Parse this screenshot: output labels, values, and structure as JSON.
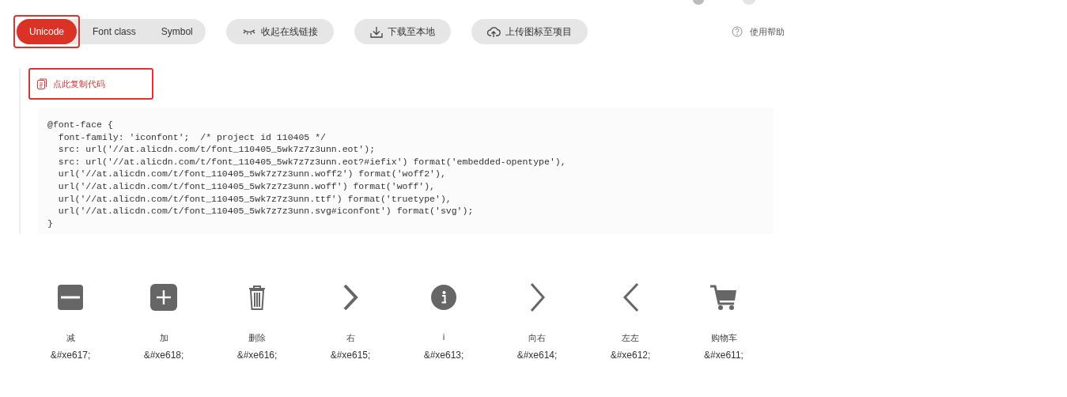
{
  "tabs": [
    {
      "label": "Unicode",
      "selected": true,
      "highlighted": true
    },
    {
      "label": "Font class",
      "selected": false,
      "highlighted": false
    },
    {
      "label": "Symbol",
      "selected": false,
      "highlighted": false
    }
  ],
  "actions": [
    {
      "label": "收起在线链接",
      "kind": "eye"
    },
    {
      "label": "下载至本地",
      "kind": "download"
    },
    {
      "label": "上传图标至项目",
      "kind": "upload"
    }
  ],
  "help": {
    "label": "使用帮助"
  },
  "copy_button": {
    "label": "点此复制代码",
    "highlighted": true
  },
  "code_lines": [
    "@font-face {",
    "  font-family: 'iconfont';  /* project id 110405 */",
    "  src: url('//at.alicdn.com/t/font_110405_5wk7z7z3unn.eot');",
    "  src: url('//at.alicdn.com/t/font_110405_5wk7z7z3unn.eot?#iefix') format('embedded-opentype'),",
    "  url('//at.alicdn.com/t/font_110405_5wk7z7z3unn.woff2') format('woff2'),",
    "  url('//at.alicdn.com/t/font_110405_5wk7z7z3unn.woff') format('woff'),",
    "  url('//at.alicdn.com/t/font_110405_5wk7z7z3unn.ttf') format('truetype'),",
    "  url('//at.alicdn.com/t/font_110405_5wk7z7z3unn.svg#iconfont') format('svg');",
    "}"
  ],
  "icons": [
    {
      "kind": "minus",
      "name": "减",
      "code": "&#xe617;"
    },
    {
      "kind": "plus",
      "name": "加",
      "code": "&#xe618;"
    },
    {
      "kind": "trash",
      "name": "删除",
      "code": "&#xe616;"
    },
    {
      "kind": "chevron-right-bold",
      "name": "右",
      "code": "&#xe615;"
    },
    {
      "kind": "info",
      "name": "i",
      "code": "&#xe613;"
    },
    {
      "kind": "chevron-right",
      "name": "向右",
      "code": "&#xe614;"
    },
    {
      "kind": "chevron-left",
      "name": "左左",
      "code": "&#xe612;"
    },
    {
      "kind": "cart",
      "name": "购物车",
      "code": "&#xe611;"
    }
  ]
}
